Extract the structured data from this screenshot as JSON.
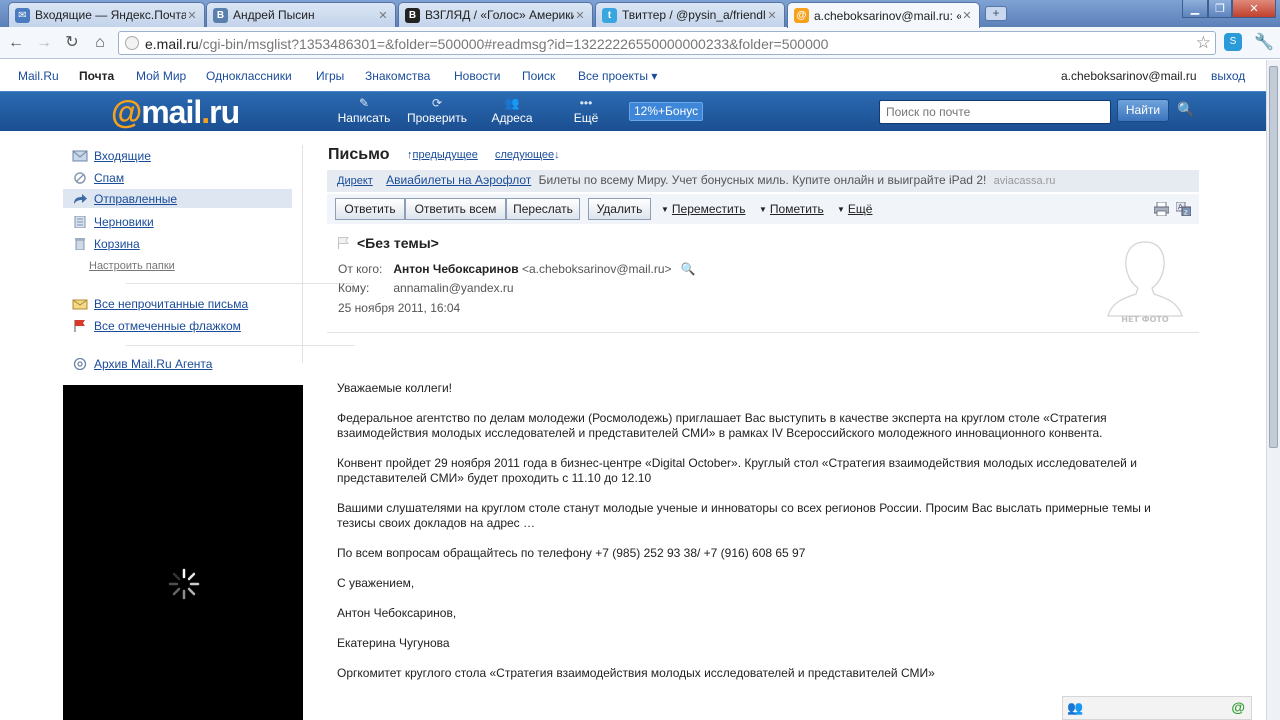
{
  "browser": {
    "tabs": [
      {
        "title": "Входящие — Яндекс.Почта",
        "color": "#4a7ac0",
        "glyph": "✉"
      },
      {
        "title": "Андрей Пысин",
        "color": "#5a7fad",
        "glyph": "В"
      },
      {
        "title": "ВЗГЛЯД / «Голос» Америки",
        "color": "#222222",
        "glyph": "В"
      },
      {
        "title": "Твиттер / @pysin_a/friendlist",
        "color": "#3aa6e0",
        "glyph": "t"
      },
      {
        "title": "a.cheboksarinov@mail.ru: «",
        "color": "#f7a21b",
        "glyph": "@"
      }
    ],
    "url_host": "e.mail.ru",
    "url_path": "/cgi-bin/msglist?1353486301=&folder=500000#readmsg?id=13222226550000000233&folder=500000"
  },
  "portal": {
    "links": [
      "Mail.Ru",
      "Почта",
      "Мой Мир",
      "Одноклассники",
      "Игры",
      "Знакомства",
      "Новости",
      "Поиск",
      "Все проекты ▾"
    ],
    "user_email": "a.cheboksarinov@mail.ru",
    "logout": "выход"
  },
  "header": {
    "logo_at": "@",
    "logo_mail": "mail",
    "logo_dot": ".",
    "logo_ru": "ru",
    "tools": {
      "compose": "Написать",
      "check": "Проверить",
      "addresses": "Адреса",
      "more": "Ещё"
    },
    "bonus": "12%+Бонус",
    "search_placeholder": "Поиск по почте",
    "search_button": "Найти"
  },
  "sidebar": {
    "folders": [
      "Входящие",
      "Спам",
      "Отправленные",
      "Черновики",
      "Корзина"
    ],
    "setup": "Настроить папки",
    "unread": "Все непрочитанные письма",
    "flagged": "Все отмеченные флажком",
    "archive": "Архив Mail.Ru Агента"
  },
  "message": {
    "heading": "Письмо",
    "prev": "предыдущее",
    "next": "следующее",
    "ad": {
      "label": "Директ",
      "link": "Авиабилеты на Аэрофлот",
      "text": "Билеты по всему Миру. Учет бонусных миль. Купите онлайн и выиграйте iPad 2!",
      "domain": "aviacassa.ru"
    },
    "actions": {
      "reply": "Ответить",
      "reply_all": "Ответить всем",
      "forward": "Переслать",
      "delete": "Удалить",
      "move": "Переместить",
      "mark": "Пометить",
      "more": "Ещё"
    },
    "subject": "<Без темы>",
    "from_label": "От кого:",
    "from_name": "Антон Чебоксаринов",
    "from_email": "<a.cheboksarinov@mail.ru>",
    "to_label": "Кому:",
    "to": "annamalin@yandex.ru",
    "date": "25 ноября 2011, 16:04",
    "no_photo": "НЕТ ФОТО",
    "body": [
      "Уважаемые коллеги!",
      "Федеральное агентство по делам молодежи (Росмолодежь) приглашает Вас выступить в качестве эксперта на круглом столе «Стратегия взаимодействия молодых исследователей и представителей СМИ» в рамках IV Всероссийского молодежного инновационного конвента.",
      "Конвент пройдет 29 ноября 2011 года в бизнес-центре «Digital October». Круглый стол «Стратегия взаимодействия молодых исследователей и представителей СМИ» будет проходить с 11.10 до 12.10",
      "Вашими слушателями на круглом столе станут молодые ученые и инноваторы со всех регионов России. Просим Вас выслать примерные темы и тезисы своих докладов на адрес …",
      "По всем вопросам обращайтесь по телефону +7 (985) 252 93 38/ +7 (916) 608 65 97",
      "С уважением,",
      "Антон Чебоксаринов,",
      "Екатерина Чугунова",
      "Оргкомитет круглого стола «Стратегия взаимодействия молодых исследователей и представителей СМИ»"
    ]
  },
  "colors": {
    "header_blue": "#1b4f91",
    "link": "#1a4c9a",
    "logo_orange": "#f7a21b"
  }
}
